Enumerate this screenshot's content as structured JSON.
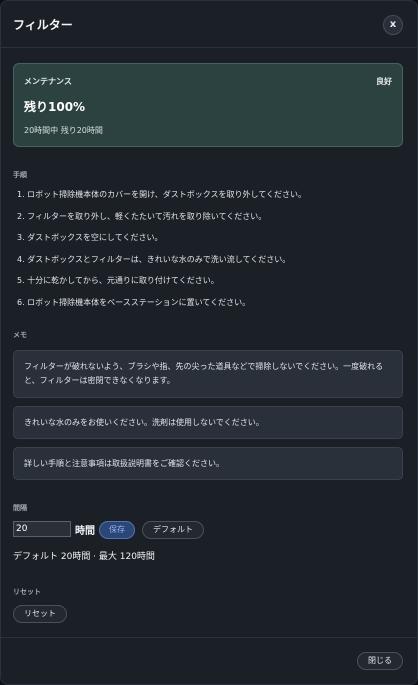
{
  "dialog": {
    "title": "フィルター",
    "close_label": "x"
  },
  "status": {
    "label": "メンテナンス",
    "badge": "良好",
    "value": "残り100%",
    "detail": "20時間中 残り20時間",
    "colors": {
      "card": "#2c4240",
      "border": "#45625f"
    }
  },
  "steps": {
    "heading": "手順",
    "items": [
      "1. ロボット掃除機本体のカバーを開け、ダストボックスを取り外してください。",
      "2. フィルターを取り外し、軽くたたいて汚れを取り除いてください。",
      "3. ダストボックスを空にしてください。",
      "4. ダストボックスとフィルターは、きれいな水のみで洗い流してください。",
      "5. 十分に乾かしてから、元通りに取り付けてください。",
      "6. ロボット掃除機本体をベースステーションに置いてください。"
    ]
  },
  "memo": {
    "heading": "メモ",
    "notes": [
      "フィルターが破れないよう、ブラシや指、先の尖った道具などで掃除しないでください。一度破れると、フィルターは密閉できなくなります。",
      "きれいな水のみをお使いください。洗剤は使用しないでください。",
      "詳しい手順と注意事項は取扱説明書をご確認ください。"
    ]
  },
  "interval": {
    "heading": "間隔",
    "value": "20",
    "unit": "時間",
    "save_label": "保存",
    "default_label": "デフォルト",
    "help": "デフォルト 20時間 · 最大 120時間"
  },
  "reset": {
    "heading": "リセット",
    "button_label": "リセット"
  },
  "footer": {
    "close_label": "閉じる"
  },
  "colors": {
    "accent": "#4f74b6",
    "background": "#1b1f26"
  }
}
